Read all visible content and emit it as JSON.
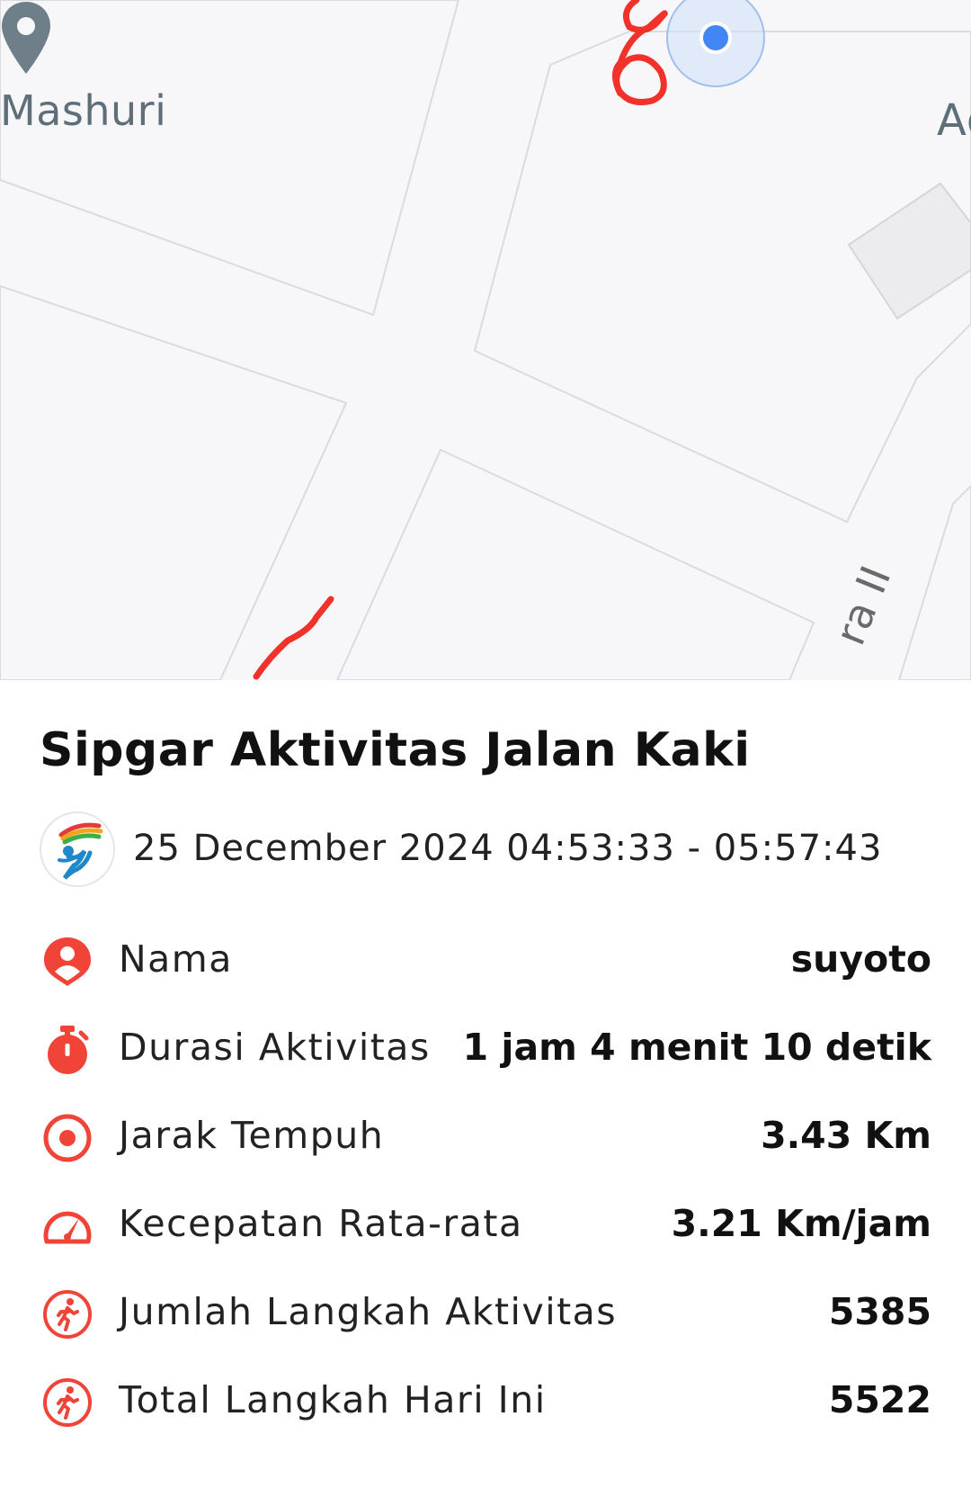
{
  "map": {
    "poi_label": "Mashuri",
    "edge_label": "Ag",
    "street_label": "ra II",
    "poi_icon": "location-pin-icon",
    "current_location_icon": "current-location-dot-icon"
  },
  "activity": {
    "title": "Sipgar Aktivitas Jalan Kaki",
    "datetime": "25 December 2024 04:53:33 - 05:57:43",
    "logo_icon": "runner-logo-icon"
  },
  "stats": [
    {
      "icon": "user-pin-icon",
      "label": "Nama",
      "value": "suyoto"
    },
    {
      "icon": "stopwatch-icon",
      "label": "Durasi Aktivitas",
      "value": "1 jam 4 menit 10 detik"
    },
    {
      "icon": "target-icon",
      "label": "Jarak Tempuh",
      "value": "3.43 Km"
    },
    {
      "icon": "speedometer-icon",
      "label": "Kecepatan Rata-rata",
      "value": "3.21 Km/jam"
    },
    {
      "icon": "walking-icon",
      "label": "Jumlah Langkah Aktivitas",
      "value": "5385"
    },
    {
      "icon": "walking-icon",
      "label": "Total Langkah Hari Ini",
      "value": "5522"
    }
  ],
  "colors": {
    "accent": "#f04438",
    "route": "#f0322a",
    "location_dot": "#4285f4",
    "map_bg": "#f7f7f9"
  }
}
